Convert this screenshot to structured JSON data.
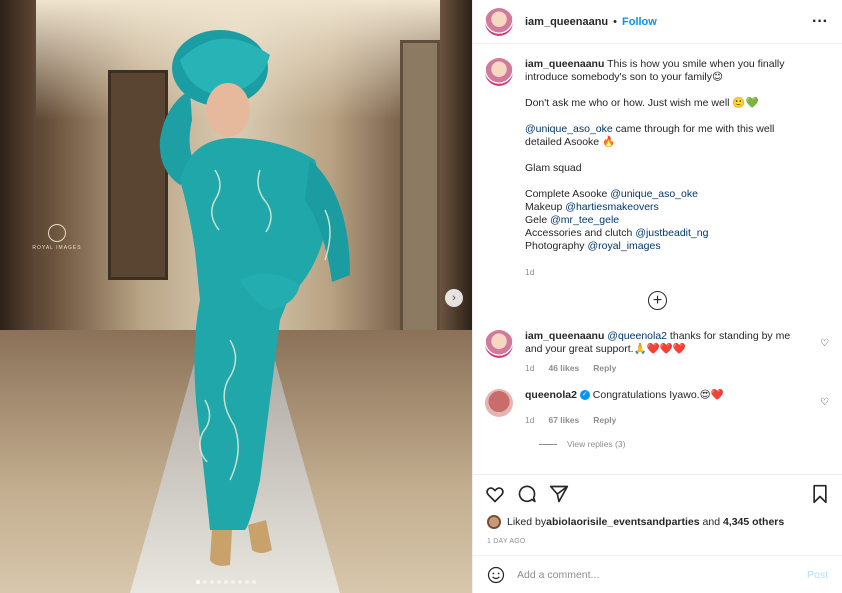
{
  "header": {
    "username": "iam_queenaanu",
    "separator": "•",
    "follow_label": "Follow",
    "more_icon": "more-horizontal-icon"
  },
  "photo": {
    "watermark": "ROYAL IMAGES",
    "slides_total": 9,
    "slide_active": 1,
    "next_icon": "chevron-right-icon"
  },
  "caption": {
    "username": "iam_queenaanu",
    "line1": "This is how you smile when you finally introduce somebody's son to your family😊",
    "line2": "Don't ask me who or how. Just wish me well 🙂💚",
    "mention1": "@unique_aso_oke",
    "line3_rest": " came through for me with this well detailed Asooke 🔥",
    "glam_title": "Glam squad",
    "credit1_label": "Complete Asooke ",
    "credit1_handle": "@unique_aso_oke",
    "credit2_label": "Makeup ",
    "credit2_handle": "@hartiesmakeovers",
    "credit3_label": "Gele ",
    "credit3_handle": "@mr_tee_gele",
    "credit4_label": "Accessories and clutch ",
    "credit4_handle": "@justbeadit_ng",
    "credit5_label": "Photography ",
    "credit5_handle": "@royal_images",
    "age": "1d"
  },
  "load_more_icon": "plus-circle-icon",
  "comments": [
    {
      "username": "iam_queenaanu",
      "mention": "@queenola2",
      "text": " thanks for standing by me and your great support.🙏❤️❤️❤️",
      "age": "1d",
      "likes": "46 likes",
      "reply": "Reply"
    },
    {
      "username": "queenola2",
      "verified": "✓",
      "text": "Congratulations Iyawo.😍❤️",
      "age": "1d",
      "likes": "67 likes",
      "reply": "Reply",
      "view_replies": "View replies (3)"
    }
  ],
  "actions": {
    "like_icon": "heart-icon",
    "comment_icon": "comment-icon",
    "share_icon": "send-icon",
    "save_icon": "bookmark-icon"
  },
  "likes": {
    "prefix": "Liked by ",
    "user": "abiolaorisile_eventsandparties",
    "middle": " and ",
    "others": "4,345 others"
  },
  "date": "1 DAY AGO",
  "add_comment": {
    "placeholder": "Add a comment...",
    "post_label": "Post",
    "emoji_icon": "smiley-icon"
  },
  "colors": {
    "accent": "#0095f6",
    "link": "#00376b",
    "muted": "#8e8e8e",
    "dress": "#1ea6a8"
  }
}
